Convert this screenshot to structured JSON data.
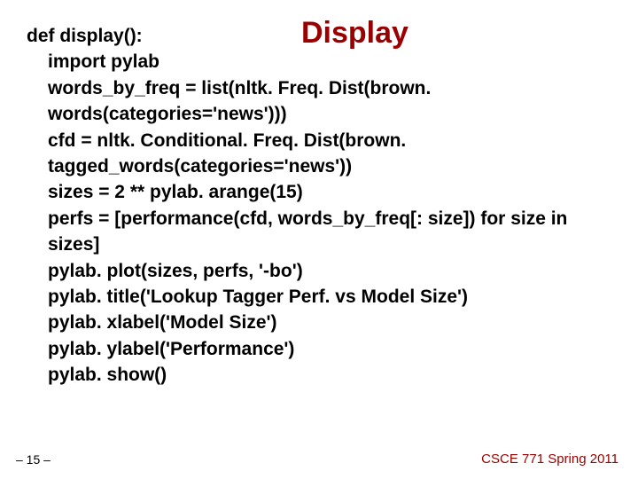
{
  "title": "Display",
  "code": {
    "l1": "def display():",
    "l2": "import pylab",
    "l3": "words_by_freq = list(nltk. Freq. Dist(brown. words(categories='news')))",
    "l4": "cfd = nltk. Conditional. Freq. Dist(brown. tagged_words(categories='news'))",
    "l5": "sizes = 2 ** pylab. arange(15)",
    "l6": "perfs = [performance(cfd, words_by_freq[: size]) for size in sizes]",
    "l7": "pylab. plot(sizes, perfs, '-bo')",
    "l8": "pylab. title('Lookup Tagger Perf. vs Model Size')",
    "l9": "pylab. xlabel('Model Size')",
    "l10": "pylab. ylabel('Performance')",
    "l11": "pylab. show()"
  },
  "footer": {
    "left": "– 15 –",
    "right": "CSCE 771 Spring 2011"
  }
}
